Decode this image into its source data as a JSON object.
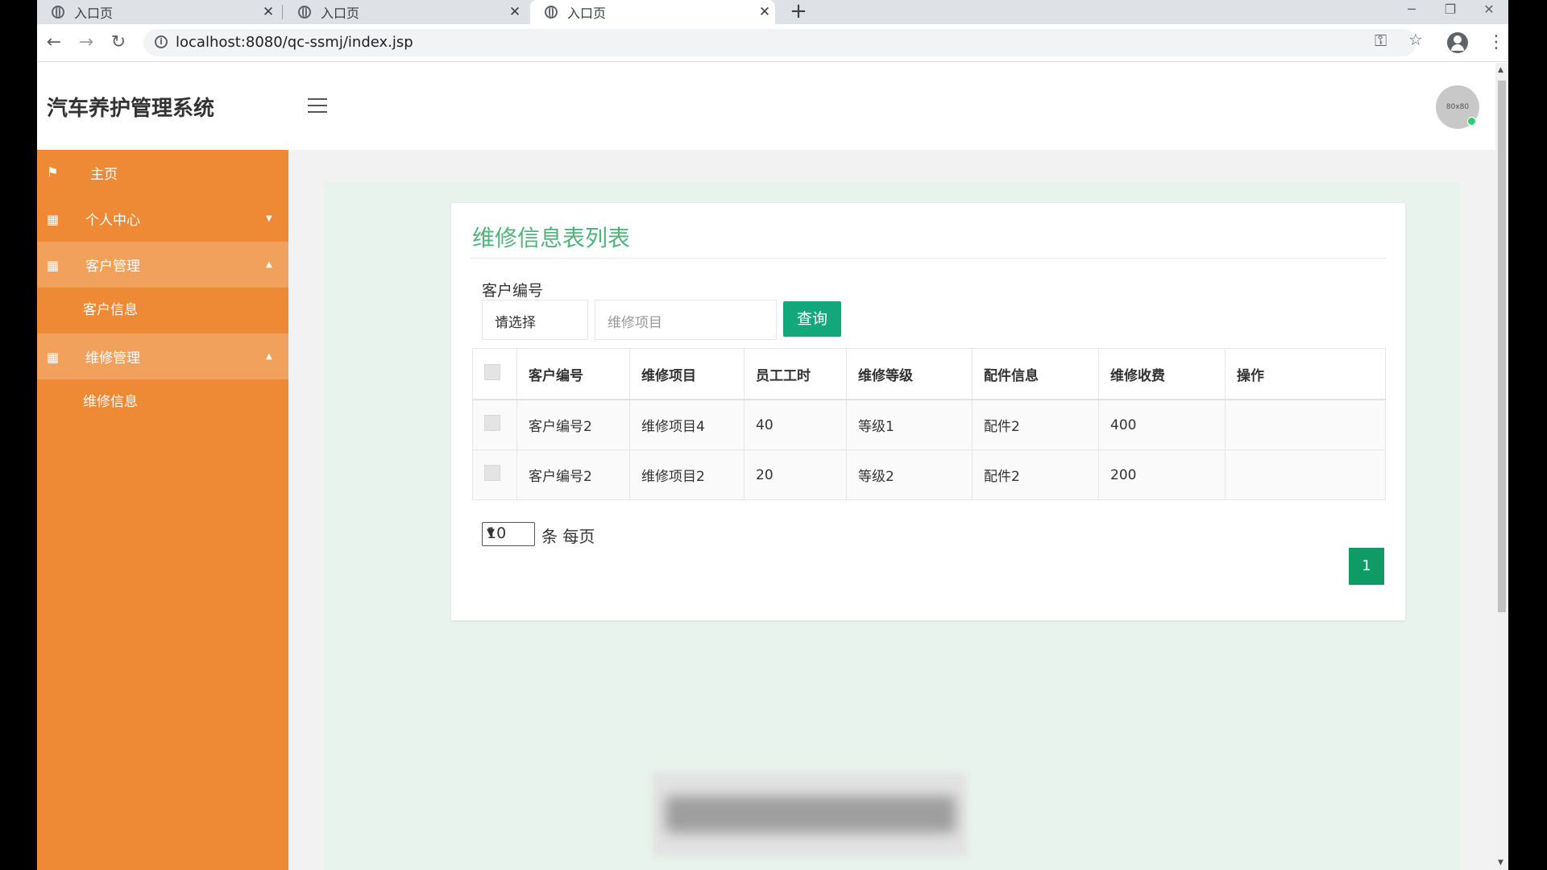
{
  "browser": {
    "tabs": [
      {
        "title": "入口页",
        "active": false
      },
      {
        "title": "入口页",
        "active": false
      },
      {
        "title": "入口页",
        "active": true
      }
    ],
    "url": "localhost:8080/qc-ssmj/index.jsp"
  },
  "header": {
    "brand": "汽车养护管理系统",
    "avatar_text": "80x80"
  },
  "sidebar": {
    "items": [
      {
        "label": "主页",
        "icon": "flag-icon"
      },
      {
        "label": "个人中心",
        "icon": "grid-icon",
        "expanded": false
      },
      {
        "label": "客户管理",
        "icon": "grid-icon",
        "expanded": true,
        "children": [
          "客户信息"
        ]
      },
      {
        "label": "维修管理",
        "icon": "grid-icon",
        "expanded": true,
        "children": [
          "维修信息"
        ]
      }
    ]
  },
  "panel": {
    "title": "维修信息表列表",
    "filter_label": "客户编号",
    "select_value": "请选择",
    "input_placeholder": "维修项目",
    "query_button": "查询"
  },
  "table": {
    "headers": [
      "客户编号",
      "维修项目",
      "员工工时",
      "维修等级",
      "配件信息",
      "维修收费",
      "操作"
    ],
    "rows": [
      [
        "客户编号2",
        "维修项目4",
        "40",
        "等级1",
        "配件2",
        "400",
        ""
      ],
      [
        "客户编号2",
        "维修项目2",
        "20",
        "等级2",
        "配件2",
        "200",
        ""
      ]
    ]
  },
  "pagination": {
    "page_size": "10",
    "per_page_label": "条 每页",
    "current_page": "1"
  },
  "colors": {
    "sidebar": "#ee8935",
    "accent_green": "#13a87a",
    "title_green": "#4fb37b"
  }
}
